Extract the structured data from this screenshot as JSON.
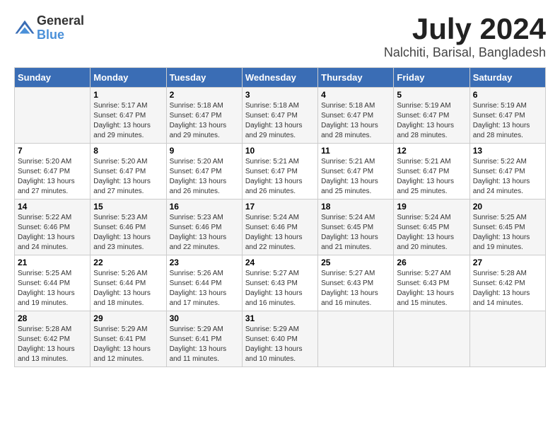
{
  "logo": {
    "general": "General",
    "blue": "Blue"
  },
  "title": "July 2024",
  "subtitle": "Nalchiti, Barisal, Bangladesh",
  "days_header": [
    "Sunday",
    "Monday",
    "Tuesday",
    "Wednesday",
    "Thursday",
    "Friday",
    "Saturday"
  ],
  "weeks": [
    [
      {
        "day": "",
        "info": ""
      },
      {
        "day": "1",
        "info": "Sunrise: 5:17 AM\nSunset: 6:47 PM\nDaylight: 13 hours\nand 29 minutes."
      },
      {
        "day": "2",
        "info": "Sunrise: 5:18 AM\nSunset: 6:47 PM\nDaylight: 13 hours\nand 29 minutes."
      },
      {
        "day": "3",
        "info": "Sunrise: 5:18 AM\nSunset: 6:47 PM\nDaylight: 13 hours\nand 29 minutes."
      },
      {
        "day": "4",
        "info": "Sunrise: 5:18 AM\nSunset: 6:47 PM\nDaylight: 13 hours\nand 28 minutes."
      },
      {
        "day": "5",
        "info": "Sunrise: 5:19 AM\nSunset: 6:47 PM\nDaylight: 13 hours\nand 28 minutes."
      },
      {
        "day": "6",
        "info": "Sunrise: 5:19 AM\nSunset: 6:47 PM\nDaylight: 13 hours\nand 28 minutes."
      }
    ],
    [
      {
        "day": "7",
        "info": "Sunrise: 5:20 AM\nSunset: 6:47 PM\nDaylight: 13 hours\nand 27 minutes."
      },
      {
        "day": "8",
        "info": "Sunrise: 5:20 AM\nSunset: 6:47 PM\nDaylight: 13 hours\nand 27 minutes."
      },
      {
        "day": "9",
        "info": "Sunrise: 5:20 AM\nSunset: 6:47 PM\nDaylight: 13 hours\nand 26 minutes."
      },
      {
        "day": "10",
        "info": "Sunrise: 5:21 AM\nSunset: 6:47 PM\nDaylight: 13 hours\nand 26 minutes."
      },
      {
        "day": "11",
        "info": "Sunrise: 5:21 AM\nSunset: 6:47 PM\nDaylight: 13 hours\nand 25 minutes."
      },
      {
        "day": "12",
        "info": "Sunrise: 5:21 AM\nSunset: 6:47 PM\nDaylight: 13 hours\nand 25 minutes."
      },
      {
        "day": "13",
        "info": "Sunrise: 5:22 AM\nSunset: 6:47 PM\nDaylight: 13 hours\nand 24 minutes."
      }
    ],
    [
      {
        "day": "14",
        "info": "Sunrise: 5:22 AM\nSunset: 6:46 PM\nDaylight: 13 hours\nand 24 minutes."
      },
      {
        "day": "15",
        "info": "Sunrise: 5:23 AM\nSunset: 6:46 PM\nDaylight: 13 hours\nand 23 minutes."
      },
      {
        "day": "16",
        "info": "Sunrise: 5:23 AM\nSunset: 6:46 PM\nDaylight: 13 hours\nand 22 minutes."
      },
      {
        "day": "17",
        "info": "Sunrise: 5:24 AM\nSunset: 6:46 PM\nDaylight: 13 hours\nand 22 minutes."
      },
      {
        "day": "18",
        "info": "Sunrise: 5:24 AM\nSunset: 6:45 PM\nDaylight: 13 hours\nand 21 minutes."
      },
      {
        "day": "19",
        "info": "Sunrise: 5:24 AM\nSunset: 6:45 PM\nDaylight: 13 hours\nand 20 minutes."
      },
      {
        "day": "20",
        "info": "Sunrise: 5:25 AM\nSunset: 6:45 PM\nDaylight: 13 hours\nand 19 minutes."
      }
    ],
    [
      {
        "day": "21",
        "info": "Sunrise: 5:25 AM\nSunset: 6:44 PM\nDaylight: 13 hours\nand 19 minutes."
      },
      {
        "day": "22",
        "info": "Sunrise: 5:26 AM\nSunset: 6:44 PM\nDaylight: 13 hours\nand 18 minutes."
      },
      {
        "day": "23",
        "info": "Sunrise: 5:26 AM\nSunset: 6:44 PM\nDaylight: 13 hours\nand 17 minutes."
      },
      {
        "day": "24",
        "info": "Sunrise: 5:27 AM\nSunset: 6:43 PM\nDaylight: 13 hours\nand 16 minutes."
      },
      {
        "day": "25",
        "info": "Sunrise: 5:27 AM\nSunset: 6:43 PM\nDaylight: 13 hours\nand 16 minutes."
      },
      {
        "day": "26",
        "info": "Sunrise: 5:27 AM\nSunset: 6:43 PM\nDaylight: 13 hours\nand 15 minutes."
      },
      {
        "day": "27",
        "info": "Sunrise: 5:28 AM\nSunset: 6:42 PM\nDaylight: 13 hours\nand 14 minutes."
      }
    ],
    [
      {
        "day": "28",
        "info": "Sunrise: 5:28 AM\nSunset: 6:42 PM\nDaylight: 13 hours\nand 13 minutes."
      },
      {
        "day": "29",
        "info": "Sunrise: 5:29 AM\nSunset: 6:41 PM\nDaylight: 13 hours\nand 12 minutes."
      },
      {
        "day": "30",
        "info": "Sunrise: 5:29 AM\nSunset: 6:41 PM\nDaylight: 13 hours\nand 11 minutes."
      },
      {
        "day": "31",
        "info": "Sunrise: 5:29 AM\nSunset: 6:40 PM\nDaylight: 13 hours\nand 10 minutes."
      },
      {
        "day": "",
        "info": ""
      },
      {
        "day": "",
        "info": ""
      },
      {
        "day": "",
        "info": ""
      }
    ]
  ]
}
